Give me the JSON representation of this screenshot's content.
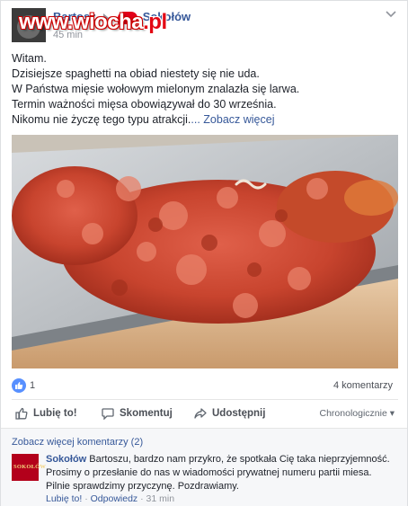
{
  "watermark": {
    "main": "www.wiocha",
    "tld": ".pl"
  },
  "post": {
    "author": "Bartosz",
    "page": "Sokołów",
    "time": "45 min",
    "lines": [
      "Witam.",
      "Dzisiejsze spaghetti na obiad niestety się nie uda.",
      "W Państwa mięsie wołowym mielonym znalazła się larwa.",
      "Termin ważności mięsa obowiązywał do 30 września.",
      "Nikomu nie życzę tego typu atrakcji."
    ],
    "see_more": "... Zobacz więcej"
  },
  "stats": {
    "likes": "1",
    "comments": "4 komentarzy"
  },
  "actions": {
    "like": "Lubię to!",
    "comment": "Skomentuj",
    "share": "Udostępnij",
    "sort": "Chronologicznie"
  },
  "comments": {
    "view_more": "Zobacz więcej komentarzy (2)",
    "items": [
      {
        "avatar_text": "SOKOŁÓW",
        "name": "Sokołów",
        "text": "Bartoszu, bardzo nam przykro, że spotkała Cię taka nieprzyjemność. Prosimy o przesłanie do nas w wiadomości prywatnej numeru partii miesa. Pilnie sprawdzimy przyczynę. Pozdrawiamy.",
        "like": "Lubię to!",
        "reply": "Odpowiedz",
        "time": "31 min"
      }
    ]
  },
  "colors": {
    "link": "#365899",
    "like_blue": "#5890ff",
    "brand_red": "#b3001b"
  }
}
